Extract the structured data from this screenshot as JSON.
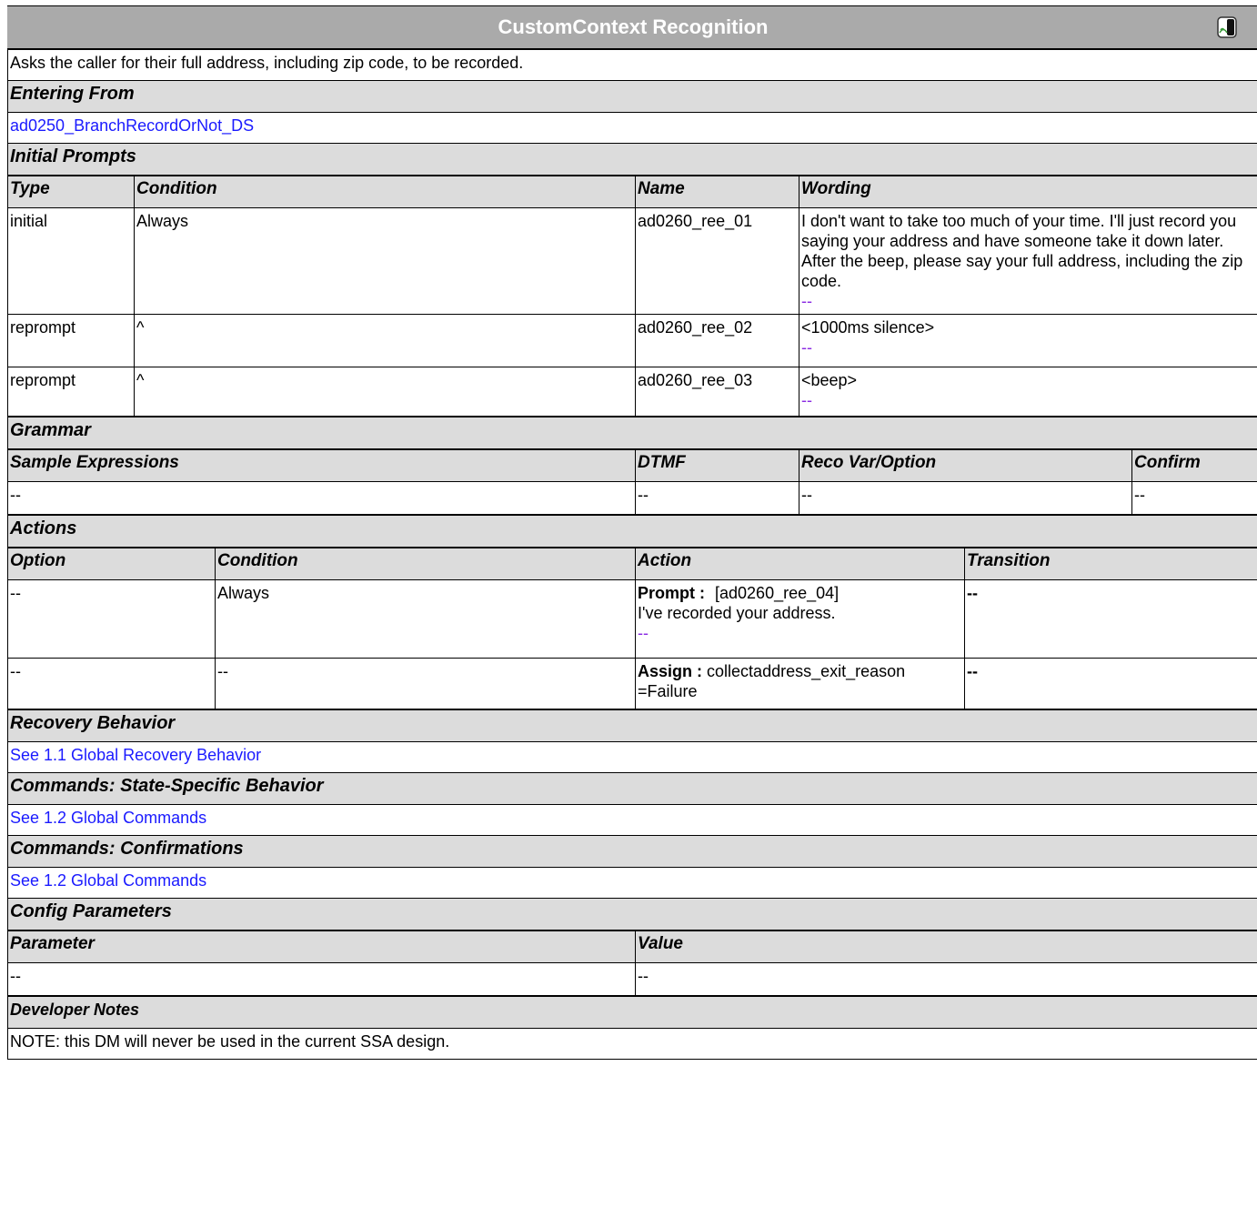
{
  "title": "CustomContext Recognition",
  "title_icon": "speech-recognition-icon",
  "description": "Asks the caller for their full address, including zip code, to be recorded.",
  "entering_from": {
    "label": "Entering From",
    "link": "ad0250_BranchRecordOrNot_DS"
  },
  "initial_prompts": {
    "label": "Initial Prompts",
    "headers": [
      "Type",
      "Condition",
      "Name",
      "Wording"
    ],
    "rows": [
      {
        "type": "initial",
        "condition": "Always",
        "name": "ad0260_ree_01",
        "wording": "I don't want to take too much of your time. I'll just record you saying your address and have someone take it down later. After the beep, please say your full address, including the zip code.",
        "link": "--"
      },
      {
        "type": "reprompt",
        "condition": "^",
        "name": "ad0260_ree_02",
        "wording": "<1000ms silence>",
        "link": "--"
      },
      {
        "type": "reprompt",
        "condition": "^",
        "name": "ad0260_ree_03",
        "wording": "<beep>",
        "link": "--"
      }
    ]
  },
  "grammar": {
    "label": "Grammar",
    "headers": [
      "Sample Expressions",
      "DTMF",
      "Reco Var/Option",
      "Confirm"
    ],
    "row": [
      "--",
      "--",
      "--",
      "--"
    ]
  },
  "actions": {
    "label": "Actions",
    "headers": [
      "Option",
      "Condition",
      "Action",
      "Transition"
    ],
    "rows": [
      {
        "option": "--",
        "condition": "Always",
        "action_label": "Prompt :",
        "action_value": "[ad0260_ree_04]",
        "action_text": "I've recorded your address.",
        "action_link": "--",
        "transition": "--"
      },
      {
        "option": "--",
        "condition": "--",
        "action_label": "Assign :",
        "action_value": "collectaddress_exit_reason",
        "action_text": "=Failure",
        "transition": "--"
      }
    ]
  },
  "recovery": {
    "label": "Recovery Behavior",
    "link": "See 1.1 Global Recovery Behavior"
  },
  "commands_state": {
    "label": "Commands: State-Specific Behavior",
    "link": "See 1.2 Global Commands"
  },
  "commands_confirm": {
    "label": "Commands: Confirmations",
    "link": "See 1.2 Global Commands"
  },
  "config": {
    "label": "Config Parameters",
    "headers": [
      "Parameter",
      "Value"
    ],
    "row": [
      "--",
      "--"
    ]
  },
  "developer_notes": {
    "label": "Developer Notes",
    "text": "NOTE: this DM will never be used in the current SSA design."
  }
}
